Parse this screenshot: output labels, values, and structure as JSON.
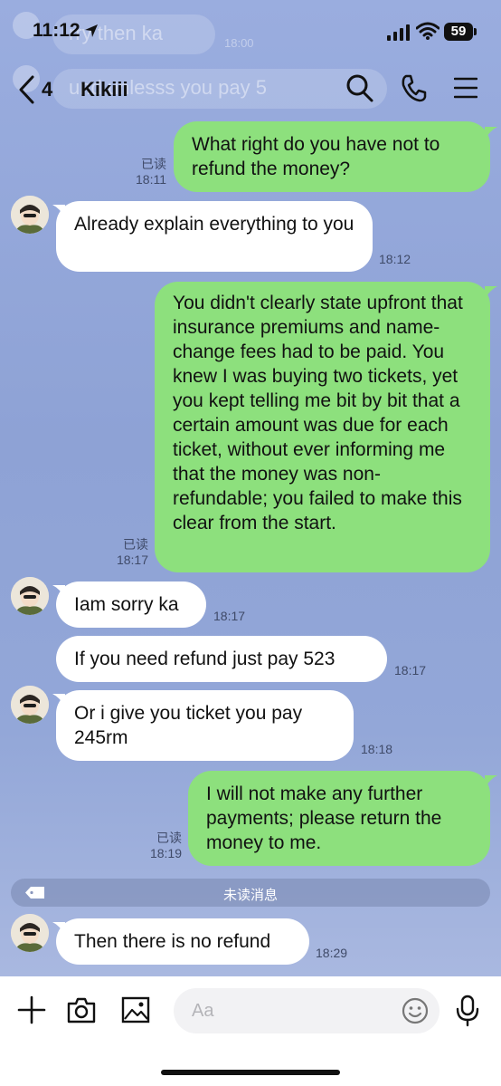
{
  "status_bar": {
    "time": "11:12",
    "battery": "59"
  },
  "background_ghosts": {
    "line1": "rry then ka",
    "line1_time": "18:00",
    "line2": "und unlesss you pay  5"
  },
  "header": {
    "back_count": "4",
    "contact_name": "Kikiii"
  },
  "messages": [
    {
      "side": "out",
      "text": "What right do you have not to refund the money?",
      "read": "已读",
      "time": "18:11"
    },
    {
      "side": "in",
      "text": "Already explain everything  to you",
      "time": "18:12"
    },
    {
      "side": "out",
      "text": "You didn't clearly state upfront that insurance premiums and name-change fees had to be paid. You knew I was buying two tickets, yet you kept telling me bit by bit that a certain amount was due for each ticket, without ever informing me that the money was non-refundable; you failed to make this clear from the start.",
      "read": "已读",
      "time": "18:17"
    },
    {
      "side": "in",
      "text": "Iam sorry ka",
      "time": "18:17"
    },
    {
      "side": "in",
      "text": "If you need  refund just pay 523",
      "time": "18:17"
    },
    {
      "side": "in",
      "text": "Or i give you ticket  you pay 245rm",
      "time": "18:18"
    },
    {
      "side": "out",
      "text": "I will not make any further payments; please return the money to me.",
      "read": "已读",
      "time": "18:19"
    },
    {
      "side": "in",
      "text": "Then there is no refund",
      "time": "18:29"
    }
  ],
  "divider": {
    "label": "未读消息"
  },
  "input_bar": {
    "placeholder": "Aa"
  },
  "colors": {
    "chat_background": "#8fa3d6",
    "outgoing_bubble": "#8de07d",
    "incoming_bubble": "#ffffff"
  },
  "icons": {
    "header": [
      "chevron-left-icon",
      "search-icon",
      "phone-icon",
      "menu-icon"
    ],
    "input": [
      "plus-icon",
      "camera-icon",
      "image-icon",
      "emoji-icon",
      "microphone-icon"
    ]
  }
}
